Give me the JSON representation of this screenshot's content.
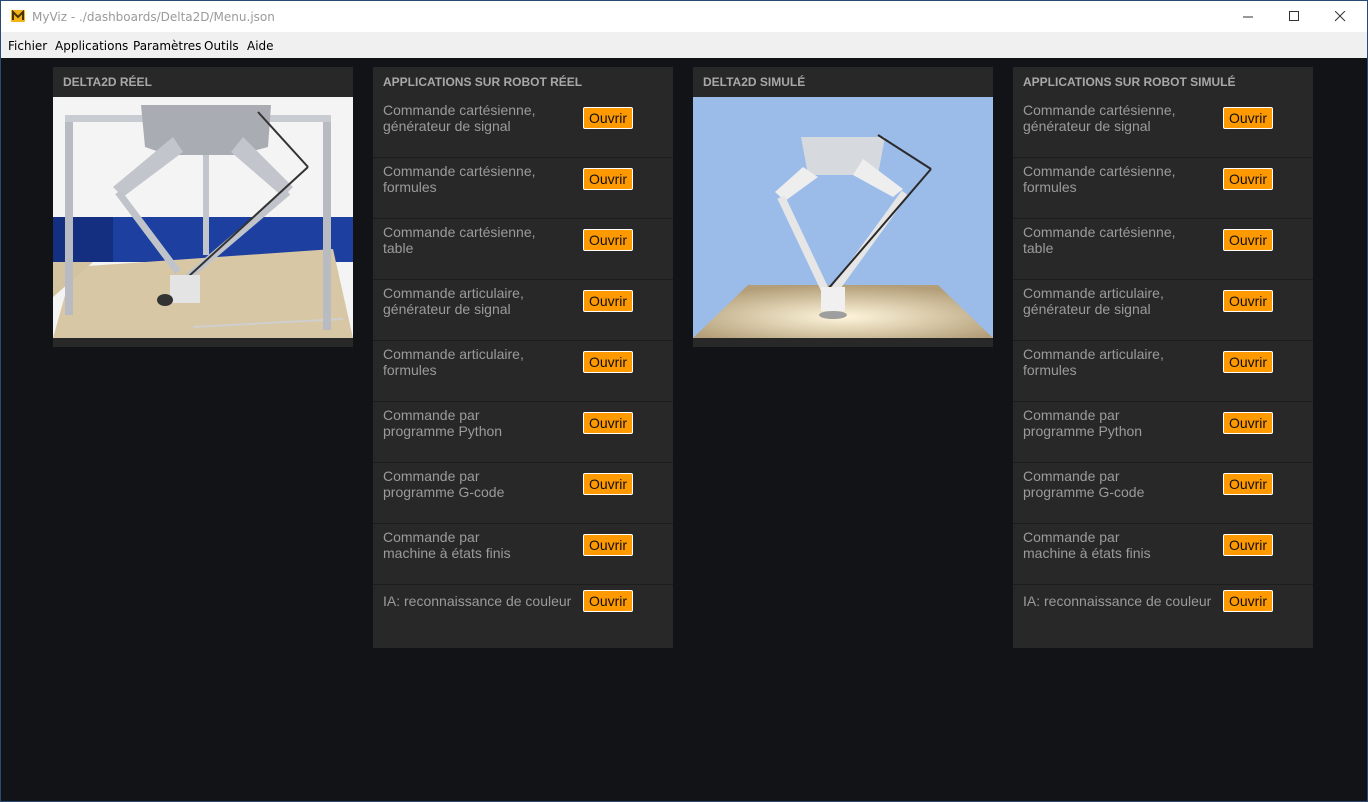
{
  "window": {
    "title": "MyViz - ./dashboards/Delta2D/Menu.json"
  },
  "menu": [
    "Fichier",
    "Applications",
    "Paramètres",
    "Outils",
    "Aide"
  ],
  "panels": {
    "real_image": {
      "title": "DELTA2D RÉEL"
    },
    "real_apps": {
      "title": "APPLICATIONS SUR ROBOT RÉEL"
    },
    "sim_image": {
      "title": "DELTA2D SIMULÉ"
    },
    "sim_apps": {
      "title": "APPLICATIONS SUR ROBOT SIMULÉ"
    }
  },
  "open_label": "Ouvrir",
  "apps": [
    [
      "Commande cartésienne,",
      "générateur de signal"
    ],
    [
      "Commande cartésienne,",
      "formules"
    ],
    [
      "Commande cartésienne,",
      "table"
    ],
    [
      "Commande articulaire,",
      "générateur de signal"
    ],
    [
      "Commande articulaire,",
      "formules"
    ],
    [
      "Commande par",
      "programme Python"
    ],
    [
      "Commande par",
      "programme G-code"
    ],
    [
      "Commande par",
      "machine à états finis"
    ],
    [
      "IA: reconnaissance de couleur"
    ]
  ],
  "colors": {
    "background": "#121316",
    "panel": "#282828",
    "button": "#ff9900",
    "sim_sky": "#9bbbe9"
  }
}
